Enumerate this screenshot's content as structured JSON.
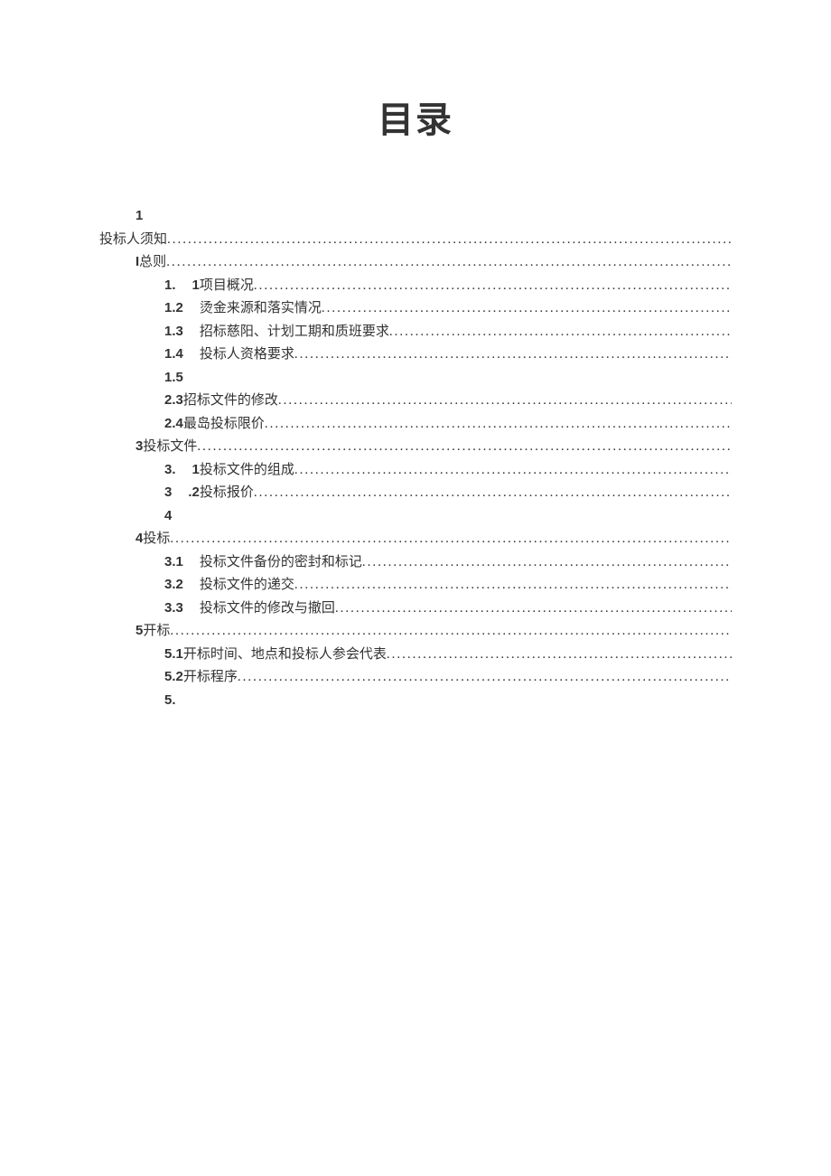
{
  "title": "目录",
  "entries": [
    {
      "indent": "indent-1",
      "prefixClass": "bold",
      "prefix": "1",
      "text": "",
      "dots": false
    },
    {
      "indent": "indent-0",
      "prefixClass": "",
      "prefix": "",
      "text": "投标人须知",
      "dots": true
    },
    {
      "indent": "indent-1",
      "prefixClass": "bold",
      "prefix": "I",
      "text": "总则",
      "dots": true
    },
    {
      "indent": "indent-2",
      "prefixClass": "bold gap-right",
      "prefix": "1.",
      "textPrefix": "1",
      "textPrefixClass": "bold",
      "text": "项目概况",
      "dots": true
    },
    {
      "indent": "indent-2",
      "prefixClass": "bold gap-right",
      "prefix": "1.2",
      "text": "烫金来源和落实情况",
      "dots": true
    },
    {
      "indent": "indent-2",
      "prefixClass": "bold gap-right",
      "prefix": "1.3",
      "text": "招标慈阳、计划工期和质班要求",
      "dots": true
    },
    {
      "indent": "indent-2",
      "prefixClass": "bold gap-right",
      "prefix": "1.4",
      "text": "投标人资格要求",
      "dots": true
    },
    {
      "indent": "indent-2",
      "prefixClass": "bold",
      "prefix": "1.5",
      "text": "",
      "dots": false
    },
    {
      "indent": "indent-2b",
      "prefixClass": "bold",
      "prefix": "2.3",
      "text": "招标文件的修改",
      "dots": true
    },
    {
      "indent": "indent-2b",
      "prefixClass": "bold",
      "prefix": "2.4",
      "text": "最岛投标限价",
      "dots": true
    },
    {
      "indent": "indent-1",
      "prefixClass": "bold",
      "prefix": "3",
      "text": "投标文件",
      "dots": true
    },
    {
      "indent": "indent-2",
      "prefixClass": "bold gap-right",
      "prefix": "3.",
      "textPrefix": "1",
      "textPrefixClass": "bold",
      "text": "投标文件的组成",
      "dots": true
    },
    {
      "indent": "indent-2",
      "prefixClass": "bold gap-right",
      "prefix": "3",
      "textPrefix": ".2",
      "textPrefixClass": "bold",
      "text": "投标报价",
      "dots": true
    },
    {
      "indent": "indent-2",
      "prefixClass": "bold",
      "prefix": "4",
      "text": "",
      "dots": false
    },
    {
      "indent": "indent-1",
      "prefixClass": "bold",
      "prefix": "4",
      "text": "投标",
      "dots": true
    },
    {
      "indent": "indent-2",
      "prefixClass": "bold gap-right",
      "prefix": "3.1",
      "text": "投标文件备份的密封和标记",
      "dots": true
    },
    {
      "indent": "indent-2",
      "prefixClass": "bold gap-right",
      "prefix": "3.2",
      "text": "投标文件的递交",
      "dots": true
    },
    {
      "indent": "indent-2",
      "prefixClass": "bold gap-right",
      "prefix": "3.3",
      "text": "投标文件的修改与撤回",
      "dots": true
    },
    {
      "indent": "indent-1",
      "prefixClass": "bold",
      "prefix": "5",
      "text": "开标",
      "dots": true
    },
    {
      "indent": "indent-2b",
      "prefixClass": "bold",
      "prefix": "5.1",
      "text": "开标时间、地点和投标人参会代表",
      "dots": true
    },
    {
      "indent": "indent-2b",
      "prefixClass": "bold",
      "prefix": "5.2",
      "text": "开标程序",
      "dots": true
    },
    {
      "indent": "indent-2b",
      "prefixClass": "bold",
      "prefix": "5.",
      "text": "",
      "dots": false
    }
  ]
}
